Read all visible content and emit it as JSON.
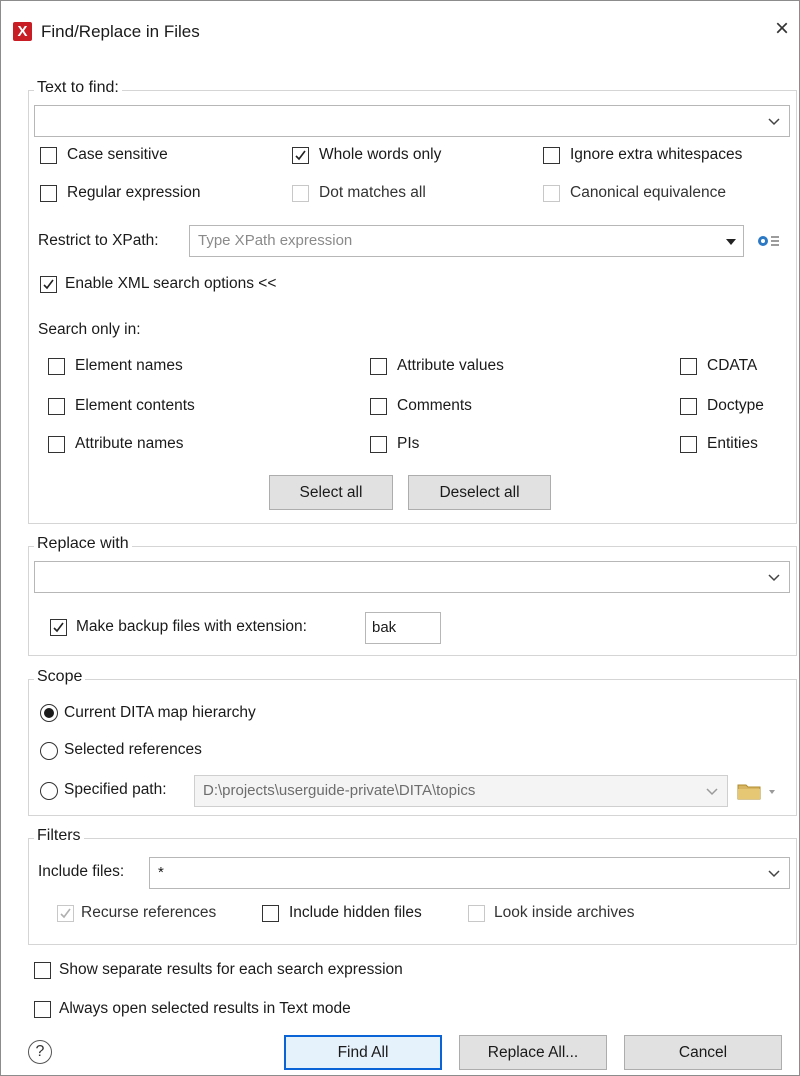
{
  "window": {
    "title": "Find/Replace in Files",
    "app_icon_glyph": "X",
    "close_glyph": "×"
  },
  "text_to_find": {
    "legend": "Text to find:",
    "value": "",
    "options": {
      "case_sensitive": {
        "label": "Case sensitive",
        "checked": false
      },
      "whole_words": {
        "label": "Whole words only",
        "checked": true
      },
      "ignore_whitespace": {
        "label": "Ignore extra whitespaces",
        "checked": false
      },
      "regex": {
        "label": "Regular expression",
        "checked": false
      },
      "dot_matches_all": {
        "label": "Dot matches all",
        "checked": false,
        "enabled": false
      },
      "canonical": {
        "label": "Canonical equivalence",
        "checked": false,
        "enabled": false
      }
    },
    "xpath": {
      "label": "Restrict to XPath:",
      "placeholder": "Type XPath expression",
      "settings_icon": "gear-settings-icon"
    },
    "xml_options": {
      "label": "Enable XML search options <<",
      "checked": true
    },
    "search_only_in": {
      "label": "Search only in:",
      "items": {
        "element_names": "Element names",
        "element_contents": "Element contents",
        "attribute_names": "Attribute names",
        "attribute_values": "Attribute values",
        "comments": "Comments",
        "pis": "PIs",
        "cdata": "CDATA",
        "doctype": "Doctype",
        "entities": "Entities"
      }
    },
    "select_all": "Select all",
    "deselect_all": "Deselect all"
  },
  "replace_with": {
    "legend": "Replace with",
    "value": "",
    "backup": {
      "label": "Make backup files with extension:",
      "checked": true,
      "extension": "bak"
    }
  },
  "scope": {
    "legend": "Scope",
    "current_dita": "Current DITA map hierarchy",
    "selected_refs": "Selected references",
    "specified_path": "Specified path:",
    "path_value": "D:\\projects\\userguide-private\\DITA\\topics",
    "selected": "current_dita"
  },
  "filters": {
    "legend": "Filters",
    "include_label": "Include files:",
    "include_value": "*",
    "recurse": {
      "label": "Recurse references",
      "checked": true,
      "enabled": false
    },
    "hidden": {
      "label": "Include hidden files",
      "checked": false
    },
    "archives": {
      "label": "Look inside archives",
      "checked": false,
      "enabled": false
    }
  },
  "bottom_options": {
    "separate_results": "Show separate results for each search expression",
    "text_mode": "Always open selected results in Text mode"
  },
  "buttons": {
    "help_glyph": "?",
    "find_all": "Find All",
    "replace_all": "Replace All...",
    "cancel": "Cancel"
  }
}
